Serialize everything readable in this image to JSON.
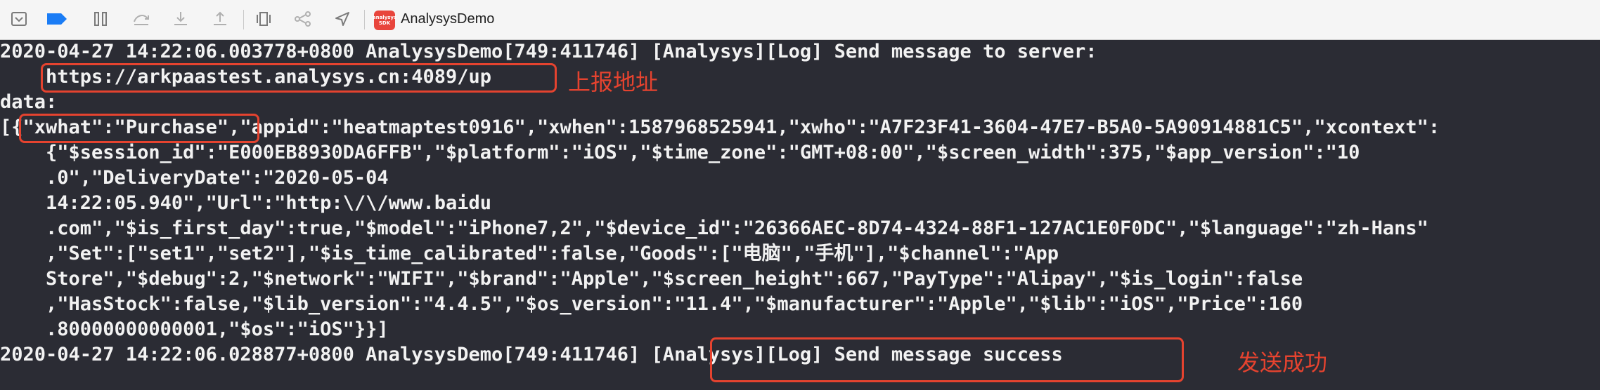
{
  "toolbar": {
    "app_badge": "analysys SDK",
    "app_name": "AnalysysDemo",
    "buttons": [
      "hide-debug-area",
      "breakpoints-toggle",
      "pause",
      "step-over",
      "step-into",
      "step-out",
      "view-debugger",
      "memory-graph",
      "simulate-location"
    ]
  },
  "console": {
    "lines": [
      "2020-04-27 14:22:06.003778+0800 AnalysysDemo[749:411746] [Analysys][Log] Send message to server:",
      "    https://arkpaastest.analysys.cn:4089/up",
      "data:",
      "[{\"xwhat\":\"Purchase\",\"appid\":\"heatmaptest0916\",\"xwhen\":1587968525941,\"xwho\":\"A7F23F41-3604-47E7-B5A0-5A90914881C5\",\"xcontext\":",
      "    {\"$session_id\":\"E000EB8930DA6FFB\",\"$platform\":\"iOS\",\"$time_zone\":\"GMT+08:00\",\"$screen_width\":375,\"$app_version\":\"10",
      "    .0\",\"DeliveryDate\":\"2020-05-04",
      "    14:22:05.940\",\"Url\":\"http:\\/\\/www.baidu",
      "    .com\",\"$is_first_day\":true,\"$model\":\"iPhone7,2\",\"$device_id\":\"26366AEC-8D74-4324-88F1-127AC1E0F0DC\",\"$language\":\"zh-Hans\"",
      "    ,\"Set\":[\"set1\",\"set2\"],\"$is_time_calibrated\":false,\"Goods\":[\"电脑\",\"手机\"],\"$channel\":\"App",
      "    Store\",\"$debug\":2,\"$network\":\"WIFI\",\"$brand\":\"Apple\",\"$screen_height\":667,\"PayType\":\"Alipay\",\"$is_login\":false",
      "    ,\"HasStock\":false,\"$lib_version\":\"4.4.5\",\"$os_version\":\"11.4\",\"$manufacturer\":\"Apple\",\"$lib\":\"iOS\",\"Price\":160",
      "    .80000000000001,\"$os\":\"iOS\"}}]",
      "2020-04-27 14:22:06.028877+0800 AnalysysDemo[749:411746] [Analysys][Log] Send message success"
    ]
  },
  "annotations": {
    "url_note": "上报地址",
    "success_note": "发送成功",
    "color": "#e5432f"
  }
}
